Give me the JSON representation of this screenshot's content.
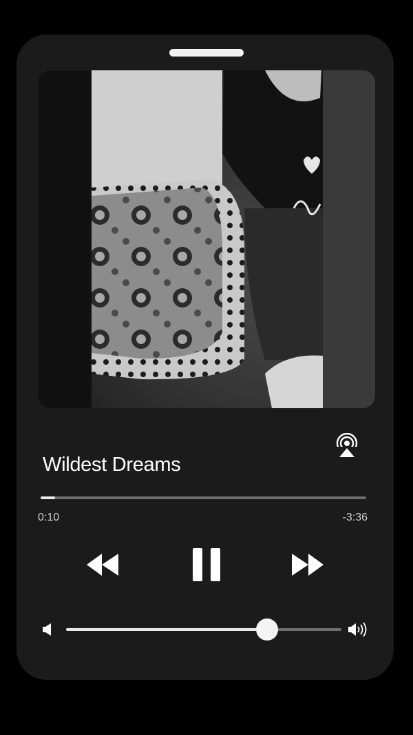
{
  "player": {
    "title": "Wildest Dreams",
    "elapsed": "0:10",
    "remaining": "-3:36",
    "progress": 0.045,
    "volume": 0.73
  },
  "icons": {
    "airplay": "airplay-icon",
    "rewind": "rewind-icon",
    "pause": "pause-icon",
    "forward": "fast-forward-icon",
    "volume_low": "volume-low-icon",
    "volume_high": "volume-high-icon"
  },
  "colors": {
    "background": "#000000",
    "card": "#1b1b1b",
    "foreground": "#ffffff",
    "track": "#6e6e6e"
  }
}
